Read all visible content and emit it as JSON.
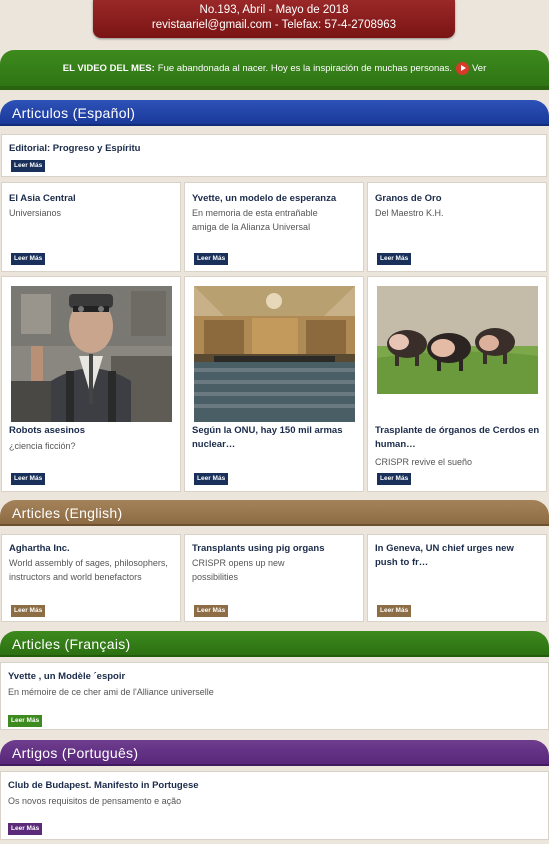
{
  "header": {
    "issue": "No.193, Abril - Mayo de 2018",
    "contact": "revistaariel@gmail.com - Telefax: 57-4-2708963"
  },
  "video": {
    "label": "EL VIDEO DEL MES:",
    "text": "Fue abandonada al nacer. Hoy es la inspiración de muchas personas.",
    "link": "Ver"
  },
  "sections": {
    "spanish": "Articulos  (Español)",
    "english": "Articles (English)",
    "french": "Articles (Français)",
    "portuguese": "Artigos (Português)"
  },
  "read_more_es": "Leer Más",
  "spanish": {
    "editorial": {
      "title": "Editorial: Progreso y Espíritu"
    },
    "row1": [
      {
        "title": "El Asia Central",
        "sub": "Universianos"
      },
      {
        "title": "Yvette, un modelo de esperanza",
        "sub": "En memoria de esta entrañable amiga de la Alianza Universal"
      },
      {
        "title": "Granos de Oro",
        "sub": "Del Maestro K.H."
      }
    ],
    "row2": [
      {
        "title": "Robots asesinos",
        "sub": " ¿ciencia ficción?"
      },
      {
        "title": "Según la ONU, hay 150 mil armas nuclear…",
        "sub": ""
      },
      {
        "title": "Trasplante de órganos de Cerdos en human…",
        "sub": "CRISPR revive el sueño"
      }
    ]
  },
  "english": [
    {
      "title": "Aghartha Inc.",
      "sub": "World assembly of sages, philosophers, instructors and world benefactors"
    },
    {
      "title": "Transplants using pig organs",
      "sub": "CRISPR opens up new possibilities"
    },
    {
      "title": "In Geneva, UN chief urges new push to fr…",
      "sub": ""
    }
  ],
  "french": {
    "title": "Yvette , un Modèle ´espoir",
    "sub": "En mémoire de ce cher ami de l'Alliance universelle"
  },
  "portuguese": {
    "title": "Club de Budapest. Manifesto in Portugese",
    "sub": "Os novos requisitos de pensamento e ação"
  },
  "colors": {
    "navy": "#18305a",
    "red_header": "#8a1e1e",
    "green": "#3d8a1e",
    "blue_bar": "#1f44a8",
    "brown": "#8c6d45",
    "purple": "#5b2a7a"
  }
}
